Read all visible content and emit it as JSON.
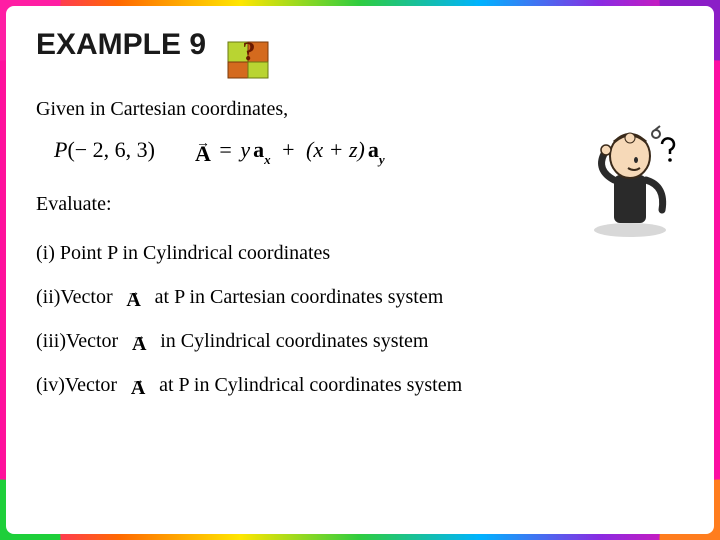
{
  "title": "EXAMPLE 9",
  "given_label": "Given in Cartesian coordinates,",
  "point": {
    "name": "P",
    "coords": "(− 2, 6, 3)"
  },
  "vector_def": {
    "lhs": "A",
    "rhs_text": "= yax + (x + z)ay",
    "rhs": {
      "term1_coef": "y",
      "term1_unit": "a",
      "term1_sub": "x",
      "op": "+",
      "term2_coef": "(x + z)",
      "term2_unit": "a",
      "term2_sub": "y"
    }
  },
  "evaluate_label": "Evaluate:",
  "items": [
    {
      "lead": "(i) Point P in Cylindrical coordinates",
      "has_vec": false,
      "tail": ""
    },
    {
      "lead": "(ii)Vector ",
      "has_vec": true,
      "vec": "A",
      "tail": " at P in Cartesian coordinates system"
    },
    {
      "lead": "(iii)Vector ",
      "has_vec": true,
      "vec": "A",
      "tail": " in Cylindrical coordinates system"
    },
    {
      "lead": "(iv)Vector ",
      "has_vec": true,
      "vec": "A",
      "tail": " at P in Cylindrical coordinates system"
    }
  ],
  "icons": {
    "puzzle": "puzzle-question-icon",
    "cartoon": "confused-person-icon"
  }
}
